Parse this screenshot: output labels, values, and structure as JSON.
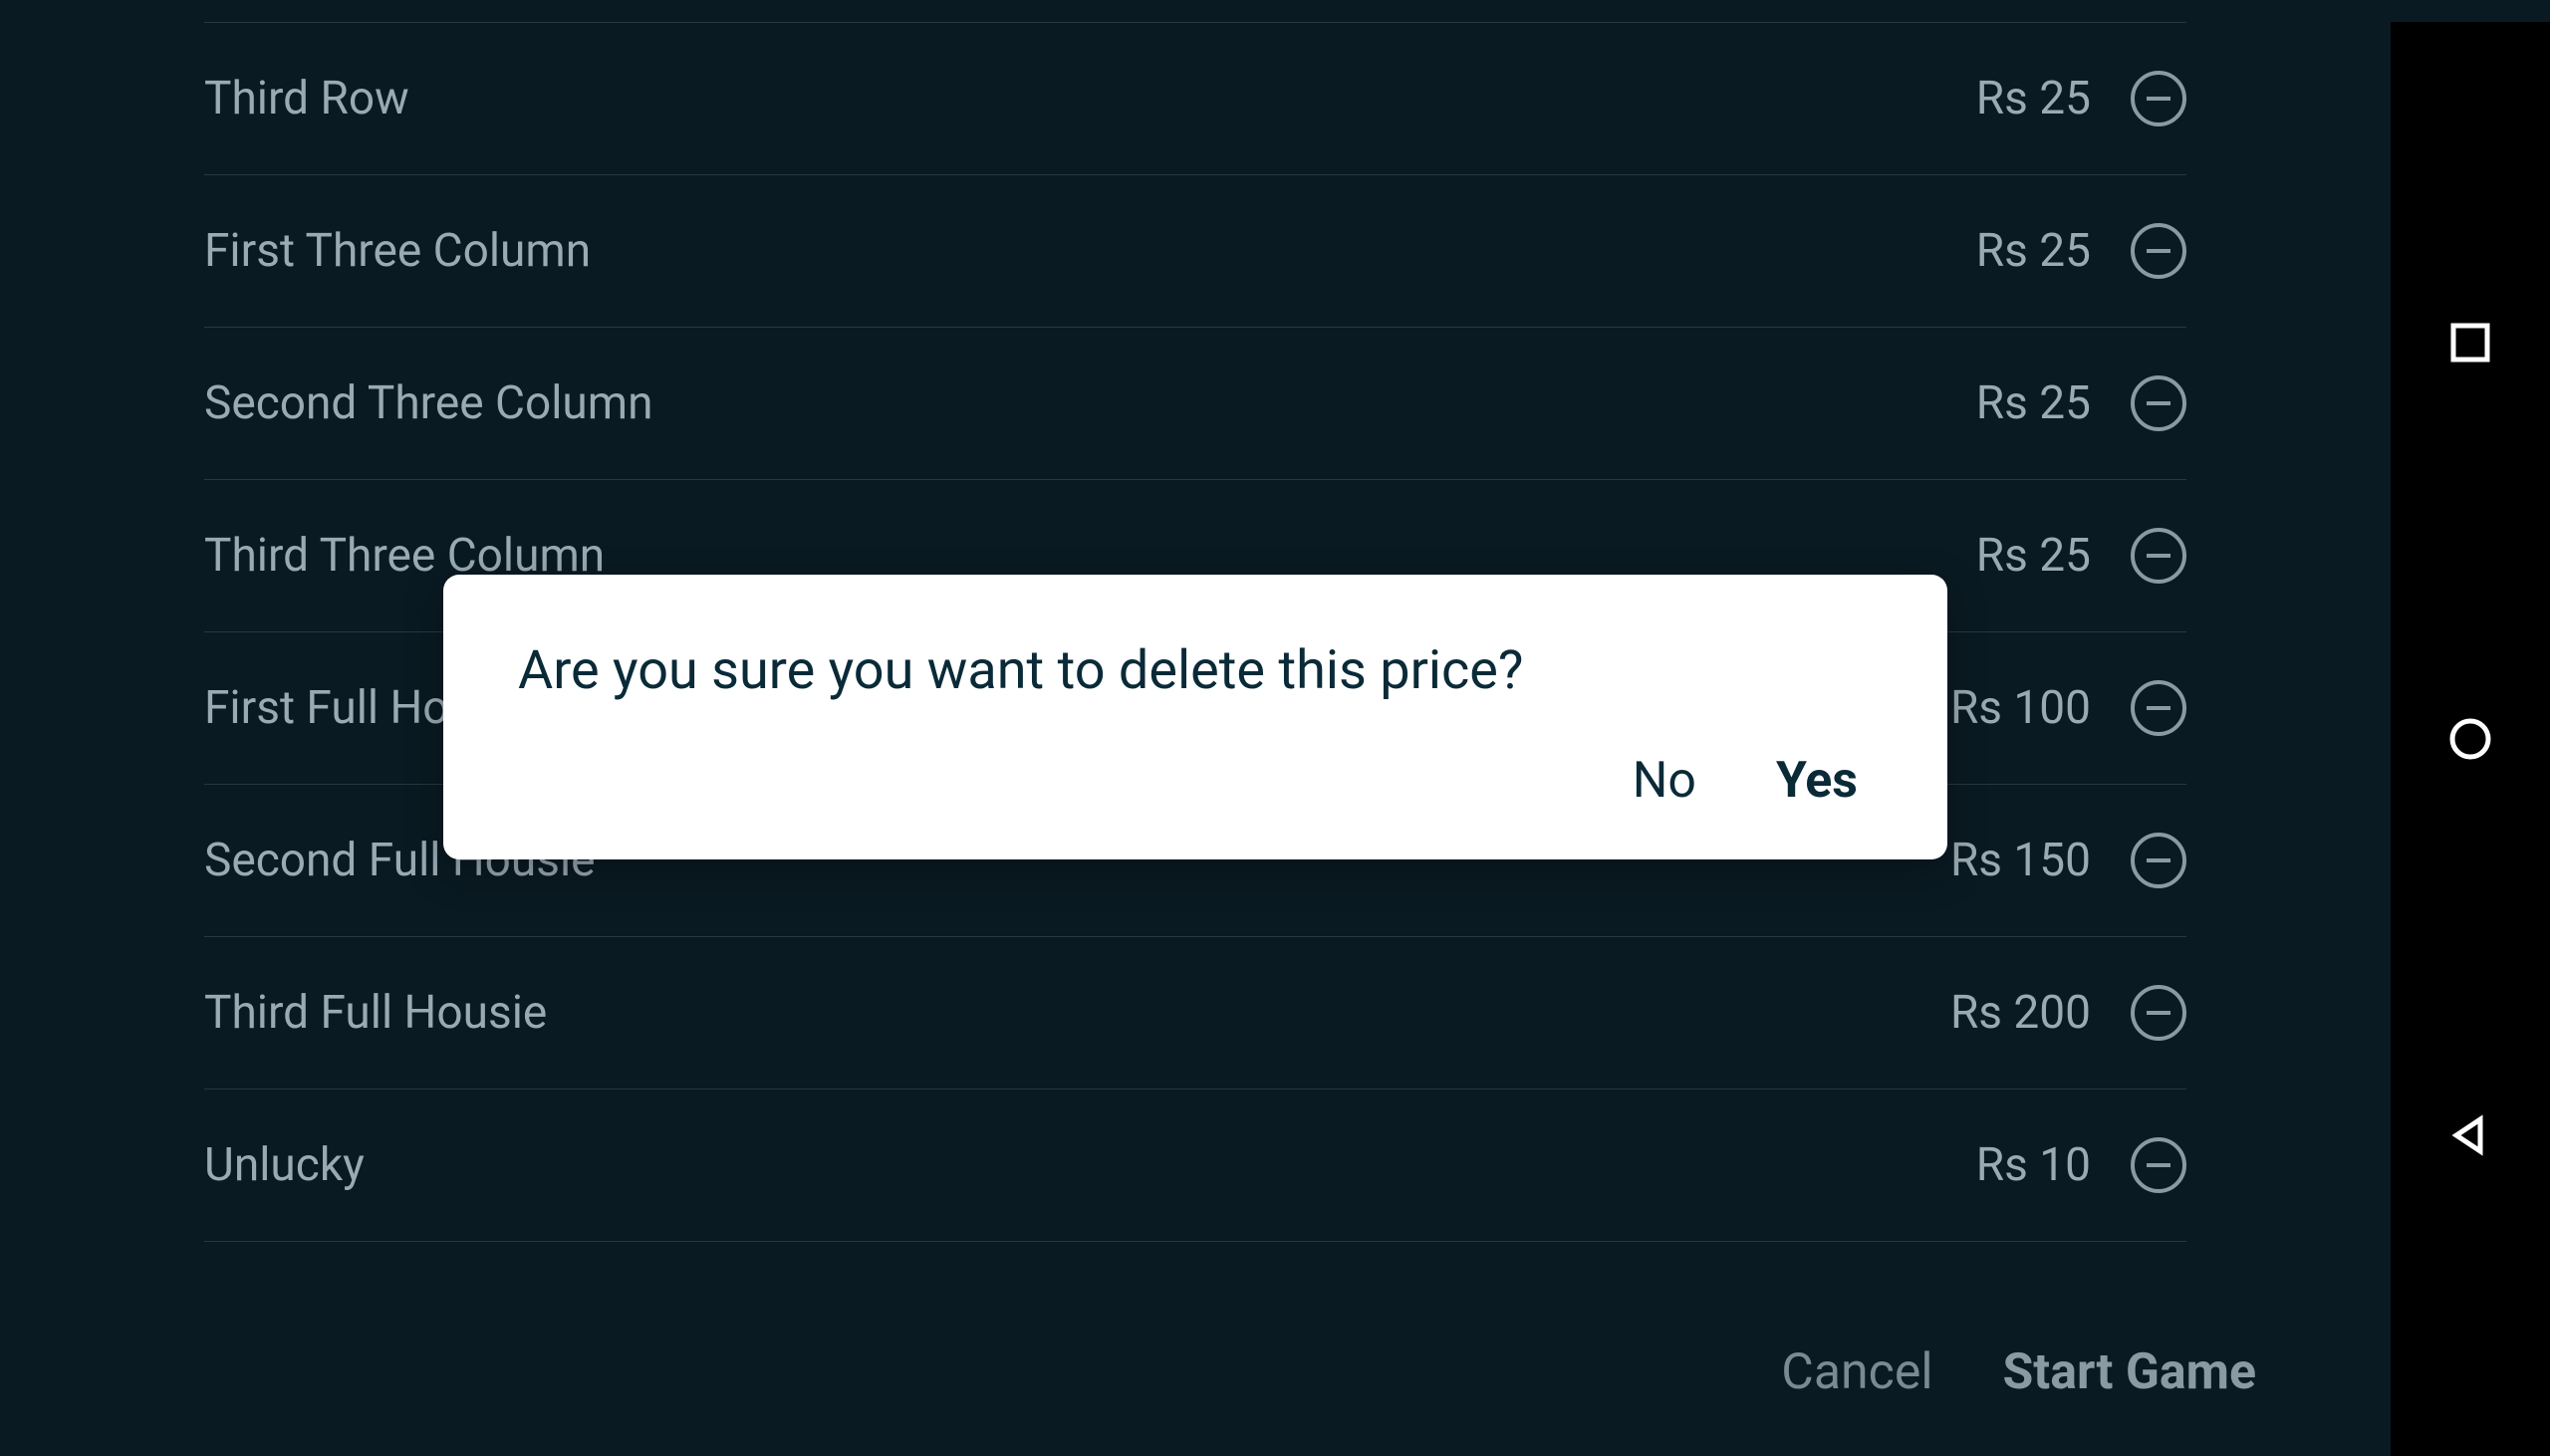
{
  "prices": [
    {
      "name": "Third Row",
      "value": "Rs 25"
    },
    {
      "name": "First Three Column",
      "value": "Rs 25"
    },
    {
      "name": "Second Three Column",
      "value": "Rs 25"
    },
    {
      "name": "Third Three Column",
      "value": "Rs 25"
    },
    {
      "name": "First Full Housie",
      "value": "Rs 100"
    },
    {
      "name": "Second Full Housie",
      "value": "Rs 150"
    },
    {
      "name": "Third Full Housie",
      "value": "Rs 200"
    },
    {
      "name": "Unlucky",
      "value": "Rs 10"
    }
  ],
  "footer": {
    "cancel": "Cancel",
    "start": "Start Game"
  },
  "modal": {
    "title": "Are you sure you want to delete this price?",
    "no": "No",
    "yes": "Yes"
  }
}
